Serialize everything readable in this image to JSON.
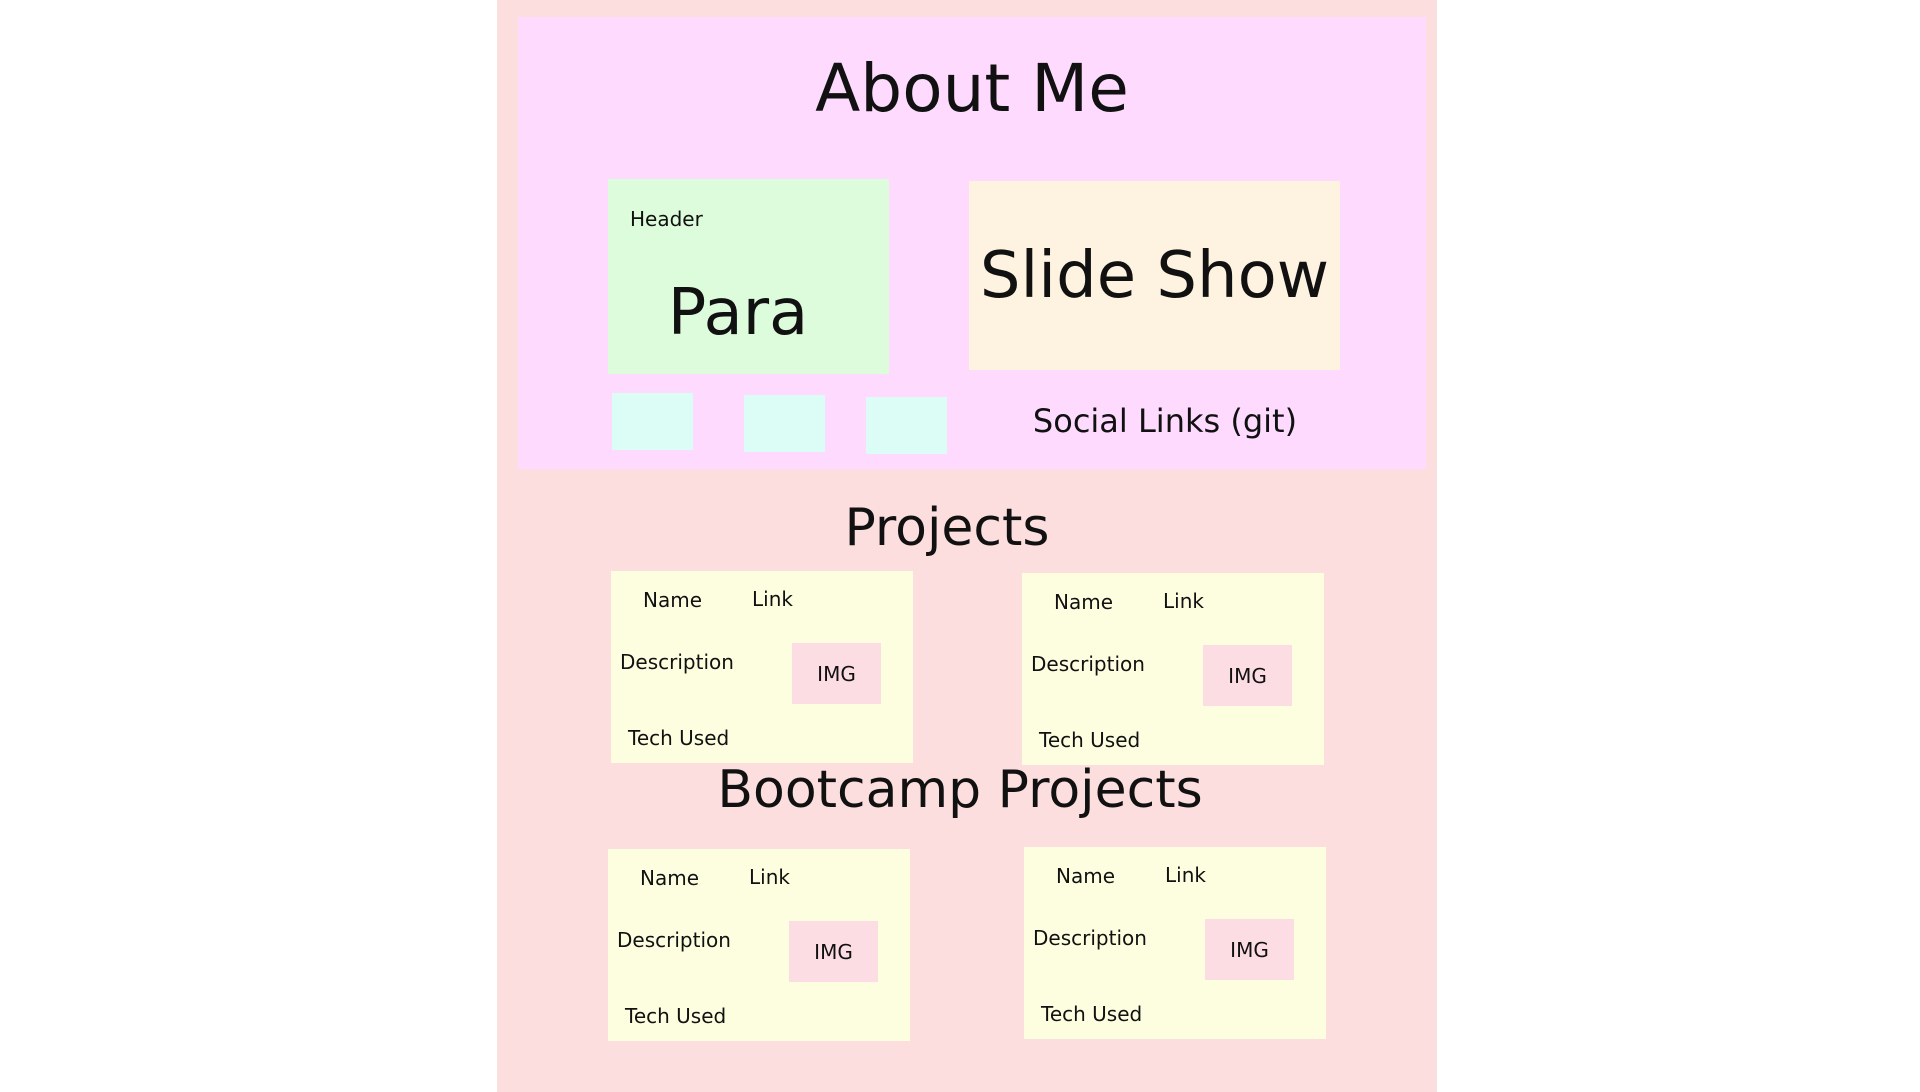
{
  "about": {
    "title": "About Me",
    "header_label": "Header",
    "para_label": "Para",
    "slideshow_label": "Slide Show",
    "social_label": "Social Links (git)"
  },
  "projects": {
    "title": "Projects",
    "cards": [
      {
        "name": "Name",
        "link": "Link",
        "description": "Description",
        "img": "IMG",
        "tech": "Tech Used"
      },
      {
        "name": "Name",
        "link": "Link",
        "description": "Description",
        "img": "IMG",
        "tech": "Tech Used"
      }
    ]
  },
  "bootcamp": {
    "title": "Bootcamp Projects",
    "cards": [
      {
        "name": "Name",
        "link": "Link",
        "description": "Description",
        "img": "IMG",
        "tech": "Tech Used"
      },
      {
        "name": "Name",
        "link": "Link",
        "description": "Description",
        "img": "IMG",
        "tech": "Tech Used"
      }
    ]
  },
  "colors": {
    "page_background": "#fddede",
    "about_background": "#fedafe",
    "header_box": "#ddfcdc",
    "slideshow_box": "#fef2e0",
    "social_squares": "#dcfcf6",
    "project_card": "#fdfedf",
    "img_placeholder": "#fddde4"
  }
}
